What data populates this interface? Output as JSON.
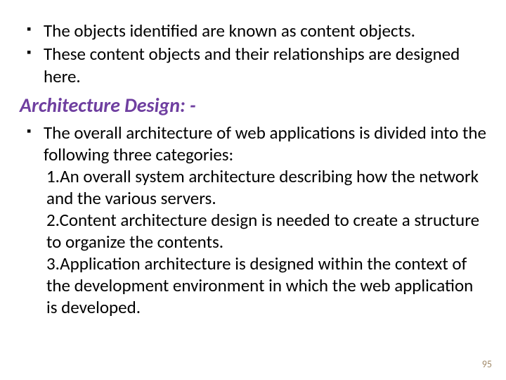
{
  "top_bullets": [
    "The objects identified are known as content objects.",
    "These content objects and their relationships are designed here."
  ],
  "heading": "Architecture Design: -",
  "body": {
    "lead": "The overall architecture of web applications is divided into the following three categories:",
    "items": [
      "1.An overall system architecture describing how the network and the various servers.",
      "2.Content architecture design is needed to create a structure to organize the contents.",
      "3.Application architecture is designed within the context of the development environment in which the web application is developed."
    ]
  },
  "page_number": "95"
}
